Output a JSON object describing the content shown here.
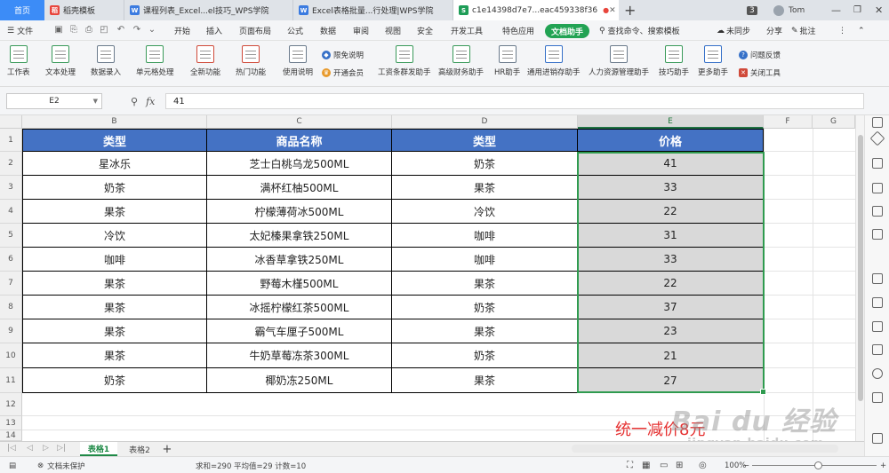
{
  "colors": {
    "header_fill": "#4472c4",
    "header_text": "#ffffff",
    "selection": "#2f9b4f",
    "price_fill": "#d9d9d9",
    "annotation": "#e63232",
    "home_tab": "#3c8cf7",
    "doc_assistant": "#22a354"
  },
  "tabs": [
    {
      "label": "首页",
      "icon": "wps-home-icon"
    },
    {
      "label": "稻壳模板",
      "icon": "docer-icon"
    },
    {
      "label": "课程列表_Excel...el技巧_WPS学院",
      "icon": "browser-icon"
    },
    {
      "label": "Excel表格批量...行处理|WPS学院",
      "icon": "browser-icon"
    },
    {
      "label": "c1e14398d7e7...eac459338f36",
      "icon": "sheet-icon"
    }
  ],
  "titlebar": {
    "window_count": "3",
    "user": "Tom"
  },
  "menu": {
    "file": "文件",
    "items": [
      "开始",
      "插入",
      "页面布局",
      "公式",
      "数据",
      "审阅",
      "视图",
      "安全",
      "开发工具",
      "特色应用"
    ],
    "doc_assistant": "文档助手",
    "search": "查找命令、搜索模板",
    "sync": "未同步",
    "share": "分享",
    "comment": "批注"
  },
  "ribbon": {
    "groups": [
      "工作表",
      "文本处理",
      "数据录入",
      "单元格处理",
      "全新功能",
      "热门功能",
      "使用说明"
    ],
    "small": {
      "free_limit": "限免说明",
      "open_member": "开通会员"
    },
    "tools": [
      "工资条群发助手",
      "高级财务助手",
      "HR助手",
      "通用进销存助手",
      "人力资源管理助手",
      "技巧助手",
      "更多助手"
    ],
    "feedback": "问题反馈",
    "close_tool": "关闭工具"
  },
  "formula_bar": {
    "cell_ref": "E2",
    "fx": "fx",
    "value": "41"
  },
  "columns": [
    "B",
    "C",
    "D",
    "E",
    "F",
    "G"
  ],
  "row_numbers": [
    "1",
    "2",
    "3",
    "4",
    "5",
    "6",
    "7",
    "8",
    "9",
    "10",
    "11",
    "12",
    "13",
    "14"
  ],
  "table": {
    "headers": [
      "类型",
      "商品名称",
      "类型",
      "价格"
    ],
    "rows": [
      [
        "星冰乐",
        "芝士白桃乌龙500ML",
        "奶茶",
        "41"
      ],
      [
        "奶茶",
        "满杯红柚500ML",
        "果茶",
        "33"
      ],
      [
        "果茶",
        "柠檬薄荷冰500ML",
        "冷饮",
        "22"
      ],
      [
        "冷饮",
        "太妃榛果拿铁250ML",
        "咖啡",
        "31"
      ],
      [
        "咖啡",
        "冰香草拿铁250ML",
        "咖啡",
        "33"
      ],
      [
        "果茶",
        "野莓木槿500ML",
        "果茶",
        "22"
      ],
      [
        "果茶",
        "冰摇柠檬红茶500ML",
        "奶茶",
        "37"
      ],
      [
        "果茶",
        "霸气车厘子500ML",
        "果茶",
        "23"
      ],
      [
        "果茶",
        "牛奶草莓冻茶300ML",
        "奶茶",
        "21"
      ],
      [
        "奶茶",
        "椰奶冻250ML",
        "果茶",
        "27"
      ]
    ]
  },
  "annotation": "统一减价8元",
  "watermark": {
    "brand": "Bai du 经验",
    "url": "jingyan.baidu.com"
  },
  "sheets": [
    {
      "label": "表格1",
      "active": true
    },
    {
      "label": "表格2",
      "active": false
    }
  ],
  "status": {
    "protect": "文档未保护",
    "stats": "求和=290  平均值=29  计数=10",
    "zoom": "100%"
  }
}
